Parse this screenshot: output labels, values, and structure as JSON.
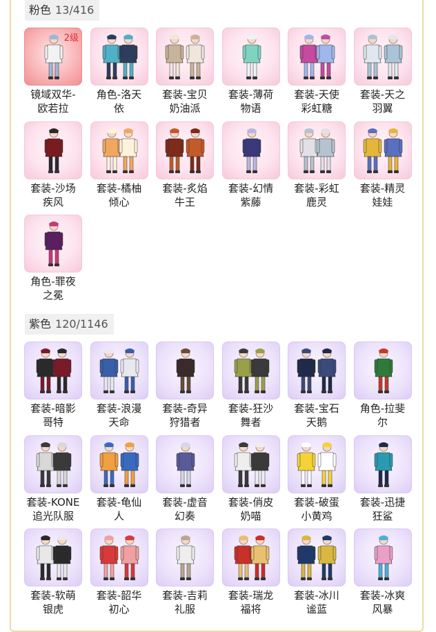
{
  "sections": [
    {
      "name": "粉色",
      "count": "13/416",
      "items": [
        {
          "label": "镜域双华-\n欧若拉",
          "badge": "2级",
          "selected": true,
          "colors": [
            "#f2f2f2",
            "#9bb8d9"
          ]
        },
        {
          "label": "角色-洛天\n依",
          "colors": [
            "#4fb0c6",
            "#2c3e5c"
          ]
        },
        {
          "label": "套装-宝贝\n奶油派",
          "colors": [
            "#c9b39a",
            "#f0e6dc"
          ]
        },
        {
          "label": "套装-薄荷\n物语",
          "colors": [
            "#7fd3c0",
            "#e9f5f2"
          ]
        },
        {
          "label": "套装-天使\n彩虹糖",
          "colors": [
            "#c64aa0",
            "#9fb7ea"
          ]
        },
        {
          "label": "套装-天之\n羽翼",
          "colors": [
            "#dfe8ee",
            "#a9c4d6"
          ]
        },
        {
          "label": "套装-沙场\n疾风",
          "colors": [
            "#7a1b20",
            "#2a2a2a"
          ]
        },
        {
          "label": "套装-橘柚\n倾心",
          "colors": [
            "#f0a860",
            "#fff2dc"
          ]
        },
        {
          "label": "套装-炙焰\n牛王",
          "colors": [
            "#7d2b1a",
            "#c25a2a"
          ]
        },
        {
          "label": "套装-幻情\n紫藤",
          "colors": [
            "#3a3a7a",
            "#b7b7e0"
          ]
        },
        {
          "label": "套装-彩虹\n鹿灵",
          "colors": [
            "#e0e0e6",
            "#b5c2d0"
          ]
        },
        {
          "label": "套装-精灵\n娃娃",
          "colors": [
            "#e5b63a",
            "#5a6fc0"
          ]
        },
        {
          "label": "角色-罪夜\n之冕",
          "colors": [
            "#5a1f5e",
            "#c43a7a"
          ]
        }
      ]
    },
    {
      "name": "紫色",
      "count": "120/1146",
      "items": [
        {
          "label": "套装-暗影\n哥特",
          "colors": [
            "#2a2a2a",
            "#7a1b2a"
          ]
        },
        {
          "label": "套装-浪漫\n天命",
          "colors": [
            "#3a5fa8",
            "#e8e8f0"
          ]
        },
        {
          "label": "套装-奇异\n狩猎者",
          "colors": [
            "#3a2a2a",
            "#6a4a3a"
          ]
        },
        {
          "label": "套装-狂沙\n舞者",
          "colors": [
            "#9aa04a",
            "#3a3a3a"
          ]
        },
        {
          "label": "套装-宝石\n天鹅",
          "colors": [
            "#1f2a4a",
            "#3a4a7a"
          ]
        },
        {
          "label": "角色-拉斐\n尔",
          "colors": [
            "#2e7a3a",
            "#c23a2a"
          ]
        },
        {
          "label": "套装-KONE\n追光队服",
          "colors": [
            "#d8d8d8",
            "#3a3a3a"
          ]
        },
        {
          "label": "套装-龟仙\n人",
          "colors": [
            "#f0a040",
            "#3a6ac0"
          ]
        },
        {
          "label": "套装-虚音\n幻奏",
          "colors": [
            "#5a5a9a",
            "#d6d6ea"
          ]
        },
        {
          "label": "套装-俏皮\n奶喵",
          "colors": [
            "#eeeeee",
            "#3a3a3a"
          ]
        },
        {
          "label": "套装-破蛋\n小黄鸡",
          "colors": [
            "#f5d23a",
            "#ffffff"
          ]
        },
        {
          "label": "套装-迅捷\n狂鲨",
          "colors": [
            "#2a9ab0",
            "#1f2a4a"
          ]
        },
        {
          "label": "套装-软萌\n银虎",
          "colors": [
            "#e8e8e8",
            "#2a2a2a"
          ]
        },
        {
          "label": "套装-韶华\n初心",
          "colors": [
            "#d83a3a",
            "#f0a0a0"
          ]
        },
        {
          "label": "套装-吉莉\n礼服",
          "colors": [
            "#eeeeee",
            "#b8a890"
          ]
        },
        {
          "label": "套装-瑞龙\n福将",
          "colors": [
            "#c8302a",
            "#e8c070"
          ]
        },
        {
          "label": "套装-冰川\n谧蓝",
          "colors": [
            "#1f3a6a",
            "#d8b840"
          ]
        },
        {
          "label": "套装-冰爽\n风暴",
          "colors": [
            "#e8a0c8",
            "#4ab0d8"
          ]
        }
      ]
    }
  ]
}
